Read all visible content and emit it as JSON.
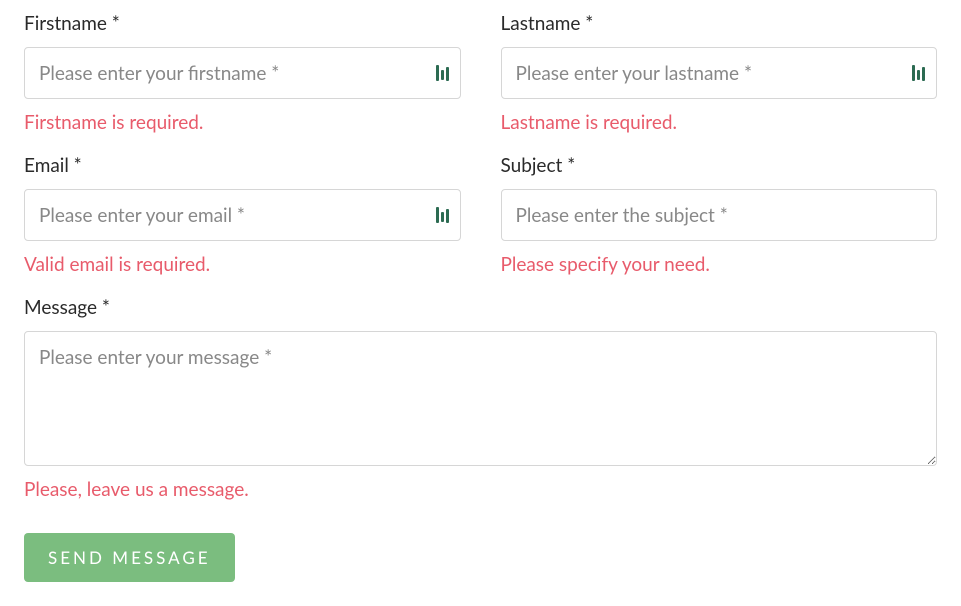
{
  "form": {
    "firstname": {
      "label": "Firstname *",
      "placeholder": "Please enter your firstname *",
      "error": "Firstname is required."
    },
    "lastname": {
      "label": "Lastname *",
      "placeholder": "Please enter your lastname *",
      "error": "Lastname is required."
    },
    "email": {
      "label": "Email *",
      "placeholder": "Please enter your email *",
      "error": "Valid email is required."
    },
    "subject": {
      "label": "Subject *",
      "placeholder": "Please enter the subject *",
      "error": "Please specify your need."
    },
    "message": {
      "label": "Message *",
      "placeholder": "Please enter your message *",
      "error": "Please, leave us a message."
    },
    "submit_label": "SEND MESSAGE"
  }
}
